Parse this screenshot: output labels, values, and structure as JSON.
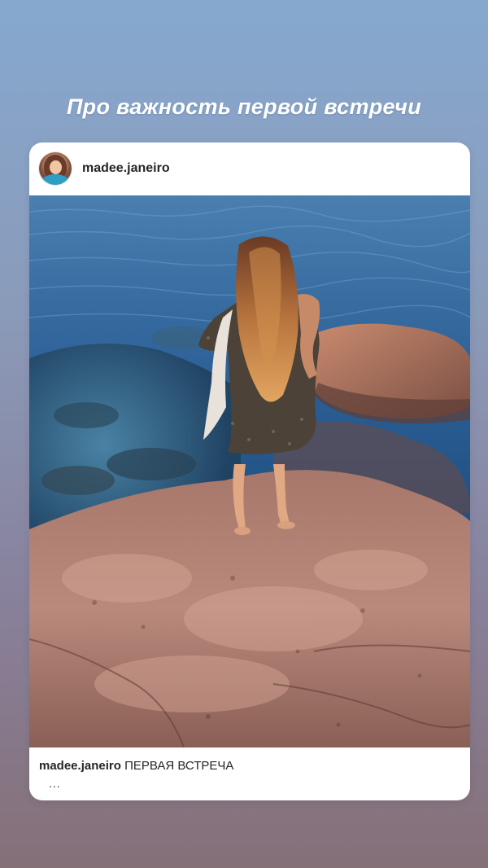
{
  "story": {
    "title": "Про важность первой встречи"
  },
  "post": {
    "username": "madee.janeiro",
    "avatar_icon": "profile-avatar",
    "caption_user": "madee.janeiro",
    "caption_text": "ПЕРВАЯ ВСТРЕЧА",
    "more_indicator": "..."
  },
  "colors": {
    "background_top": "#86a8cf",
    "background_bottom": "#857078",
    "card": "#ffffff",
    "text": "#262626"
  }
}
